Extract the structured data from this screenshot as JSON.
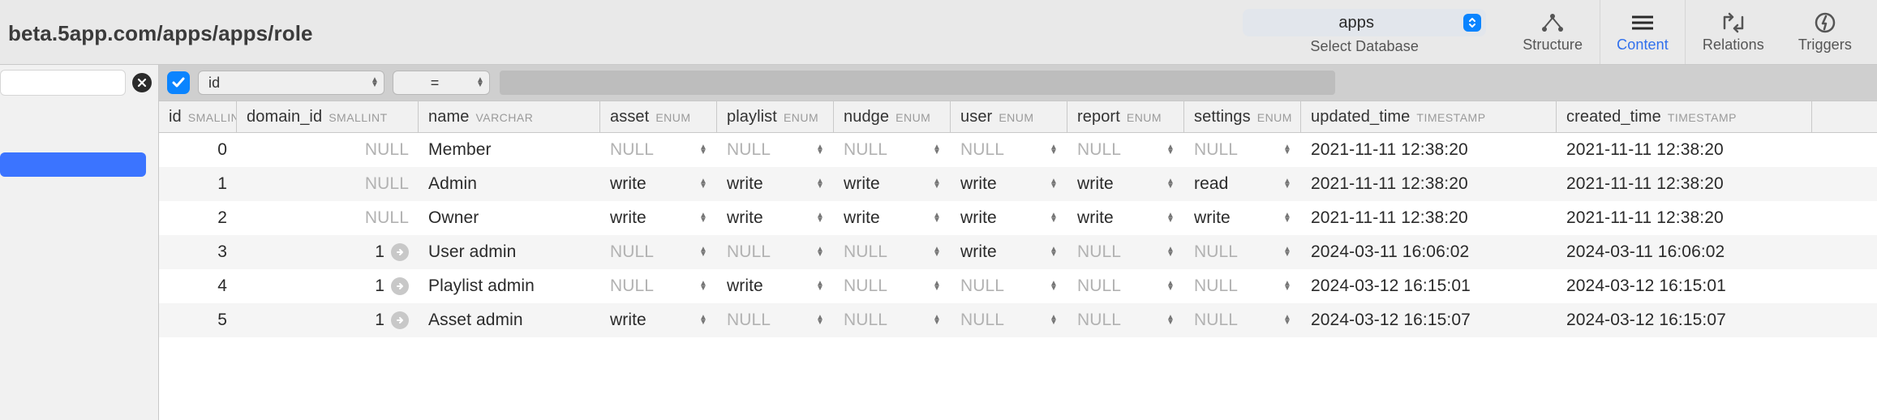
{
  "url": "beta.5app.com/apps/apps/role",
  "db_picker": {
    "selected": "apps",
    "hint": "Select Database"
  },
  "toolbar": {
    "structure": "Structure",
    "content": "Content",
    "relations": "Relations",
    "triggers": "Triggers"
  },
  "filter": {
    "enabled": true,
    "column": "id",
    "op": "="
  },
  "columns": [
    {
      "key": "id",
      "label": "id",
      "type": "SMALLINT",
      "cls": "c-id",
      "align": "right",
      "has_link": false,
      "is_enum": false
    },
    {
      "key": "domain_id",
      "label": "domain_id",
      "type": "SMALLINT",
      "cls": "c-domain",
      "align": "right",
      "has_link": true,
      "is_enum": false
    },
    {
      "key": "name",
      "label": "name",
      "type": "VARCHAR",
      "cls": "c-name",
      "align": "left",
      "has_link": false,
      "is_enum": false
    },
    {
      "key": "asset",
      "label": "asset",
      "type": "ENUM",
      "cls": "c-enum",
      "align": "left",
      "has_link": false,
      "is_enum": true
    },
    {
      "key": "playlist",
      "label": "playlist",
      "type": "ENUM",
      "cls": "c-enum",
      "align": "left",
      "has_link": false,
      "is_enum": true
    },
    {
      "key": "nudge",
      "label": "nudge",
      "type": "ENUM",
      "cls": "c-enum",
      "align": "left",
      "has_link": false,
      "is_enum": true
    },
    {
      "key": "user",
      "label": "user",
      "type": "ENUM",
      "cls": "c-enum",
      "align": "left",
      "has_link": false,
      "is_enum": true
    },
    {
      "key": "report",
      "label": "report",
      "type": "ENUM",
      "cls": "c-enum",
      "align": "left",
      "has_link": false,
      "is_enum": true
    },
    {
      "key": "settings",
      "label": "settings",
      "type": "ENUM",
      "cls": "c-enum",
      "align": "left",
      "has_link": false,
      "is_enum": true
    },
    {
      "key": "updated_time",
      "label": "updated_time",
      "type": "TIMESTAMP",
      "cls": "c-ts",
      "align": "left",
      "has_link": false,
      "is_enum": false
    },
    {
      "key": "created_time",
      "label": "created_time",
      "type": "TIMESTAMP",
      "cls": "c-ts",
      "align": "left",
      "has_link": false,
      "is_enum": false
    }
  ],
  "rows": [
    {
      "id": "0",
      "domain_id": null,
      "name": "Member",
      "asset": null,
      "playlist": null,
      "nudge": null,
      "user": null,
      "report": null,
      "settings": null,
      "updated_time": "2021-11-11 12:38:20",
      "created_time": "2021-11-11 12:38:20"
    },
    {
      "id": "1",
      "domain_id": null,
      "name": "Admin",
      "asset": "write",
      "playlist": "write",
      "nudge": "write",
      "user": "write",
      "report": "write",
      "settings": "read",
      "updated_time": "2021-11-11 12:38:20",
      "created_time": "2021-11-11 12:38:20"
    },
    {
      "id": "2",
      "domain_id": null,
      "name": "Owner",
      "asset": "write",
      "playlist": "write",
      "nudge": "write",
      "user": "write",
      "report": "write",
      "settings": "write",
      "updated_time": "2021-11-11 12:38:20",
      "created_time": "2021-11-11 12:38:20"
    },
    {
      "id": "3",
      "domain_id": "1",
      "name": "User admin",
      "asset": null,
      "playlist": null,
      "nudge": null,
      "user": "write",
      "report": null,
      "settings": null,
      "updated_time": "2024-03-11 16:06:02",
      "created_time": "2024-03-11 16:06:02"
    },
    {
      "id": "4",
      "domain_id": "1",
      "name": "Playlist admin",
      "asset": null,
      "playlist": "write",
      "nudge": null,
      "user": null,
      "report": null,
      "settings": null,
      "updated_time": "2024-03-12 16:15:01",
      "created_time": "2024-03-12 16:15:01"
    },
    {
      "id": "5",
      "domain_id": "1",
      "name": "Asset admin",
      "asset": "write",
      "playlist": null,
      "nudge": null,
      "user": null,
      "report": null,
      "settings": null,
      "updated_time": "2024-03-12 16:15:07",
      "created_time": "2024-03-12 16:15:07"
    }
  ]
}
